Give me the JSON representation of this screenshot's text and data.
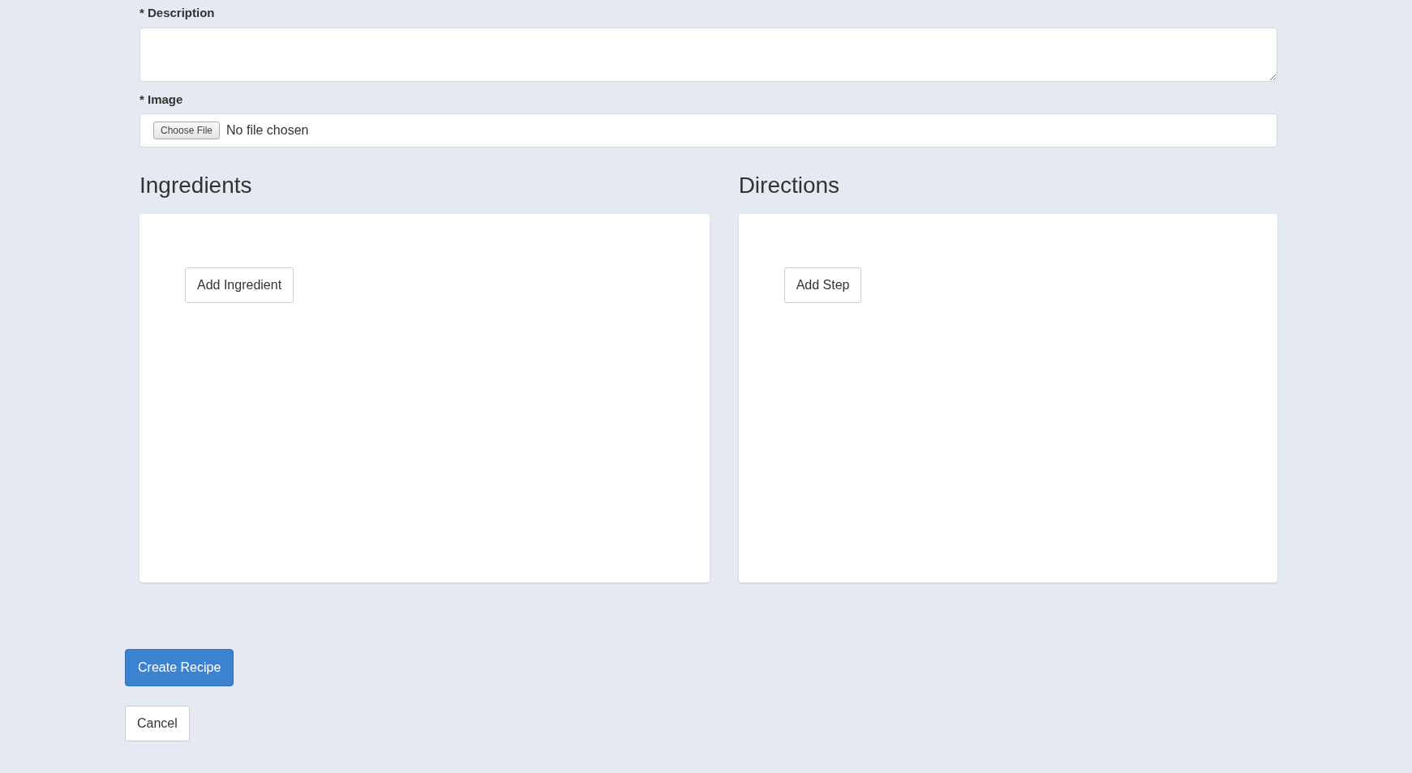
{
  "form": {
    "fields": [
      {
        "kind": "textarea",
        "label": "* Description"
      },
      {
        "kind": "file",
        "label": "* Image",
        "button": "Choose File",
        "status": "No file chosen"
      }
    ]
  },
  "sections": [
    {
      "title": "Ingredients",
      "button": "Add Ingredient"
    },
    {
      "title": "Directions",
      "button": "Add Step"
    }
  ],
  "actions": [
    {
      "kind": "primary",
      "label": "Create Recipe"
    },
    {
      "kind": "secondary",
      "label": "Cancel"
    }
  ]
}
